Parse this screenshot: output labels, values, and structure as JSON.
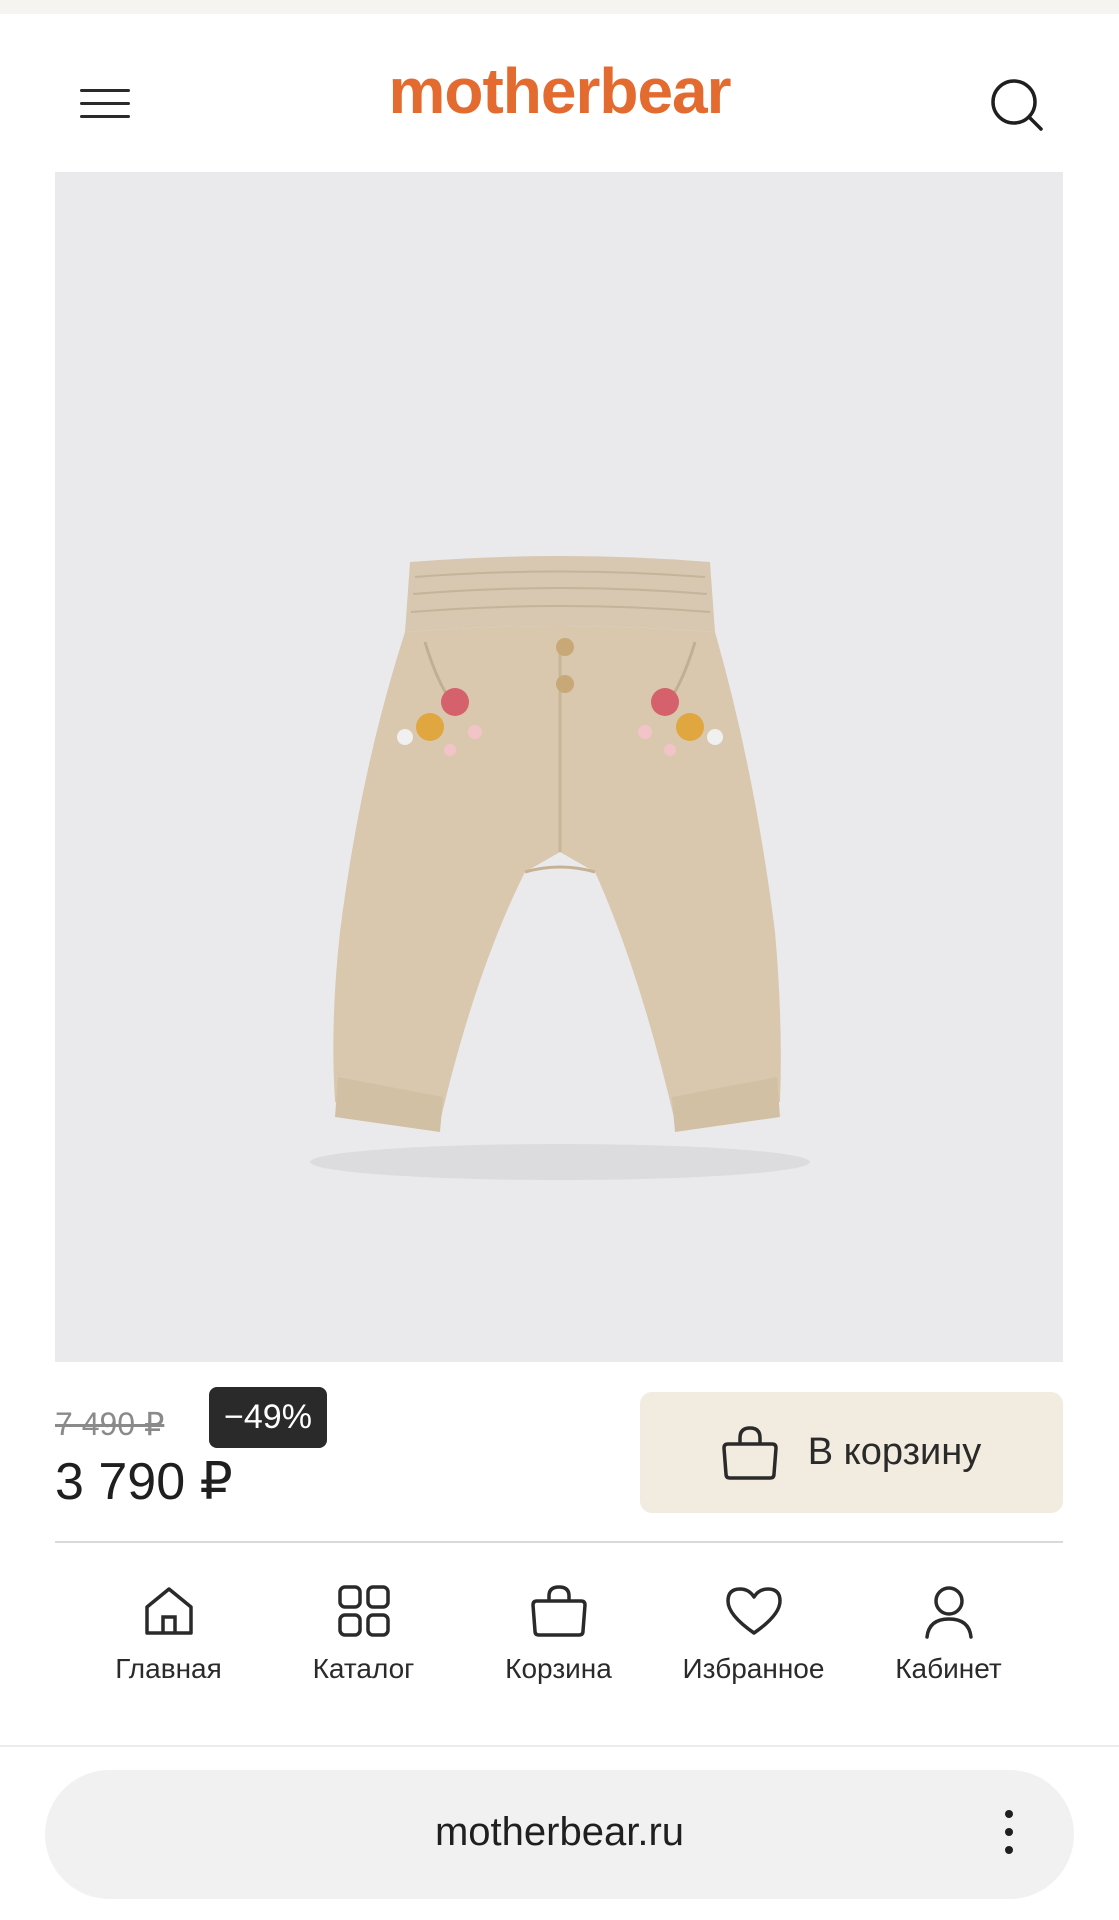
{
  "header": {
    "logo_text": "motherbear",
    "brand_color": "#e46b2f",
    "menu_icon": "hamburger-menu-icon",
    "search_icon": "search-icon"
  },
  "product": {
    "image_subject": "beige corduroy baby trousers with floral embroidery",
    "old_price": "7 490 ₽",
    "discount": "−49%",
    "price": "3 790 ₽",
    "add_to_cart_label": "В корзину",
    "add_to_cart_icon": "shopping-bag-icon"
  },
  "bottom_nav": {
    "items": [
      {
        "label": "Главная",
        "icon": "home-icon"
      },
      {
        "label": "Каталог",
        "icon": "grid-icon"
      },
      {
        "label": "Корзина",
        "icon": "shopping-bag-icon"
      },
      {
        "label": "Избранное",
        "icon": "heart-icon"
      },
      {
        "label": "Кабинет",
        "icon": "user-icon"
      }
    ]
  },
  "browser": {
    "url": "motherbear.ru",
    "more_icon": "more-vertical-icon"
  }
}
